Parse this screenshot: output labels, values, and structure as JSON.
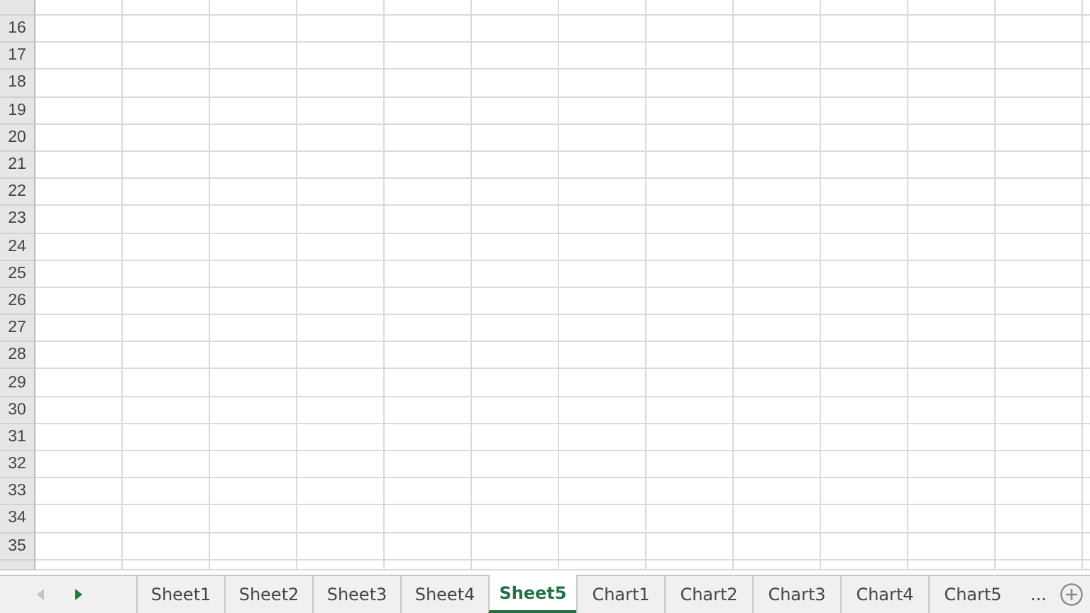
{
  "rows": [
    "16",
    "17",
    "18",
    "19",
    "20",
    "21",
    "22",
    "23",
    "24",
    "25",
    "26",
    "27",
    "28",
    "29",
    "30",
    "31",
    "32",
    "33",
    "34",
    "35"
  ],
  "tab_scroll": {
    "left_disabled": true,
    "right_disabled": false
  },
  "sheet_tabs": [
    {
      "label": "Sheet1",
      "selected": false
    },
    {
      "label": "Sheet2",
      "selected": false
    },
    {
      "label": "Sheet3",
      "selected": false
    },
    {
      "label": "Sheet4",
      "selected": false
    },
    {
      "label": "Sheet5",
      "selected": true
    },
    {
      "label": "Chart1",
      "selected": false
    },
    {
      "label": "Chart2",
      "selected": false
    },
    {
      "label": "Chart3",
      "selected": false
    },
    {
      "label": "Chart4",
      "selected": false
    },
    {
      "label": "Chart5",
      "selected": false
    }
  ],
  "more_tabs": "..."
}
